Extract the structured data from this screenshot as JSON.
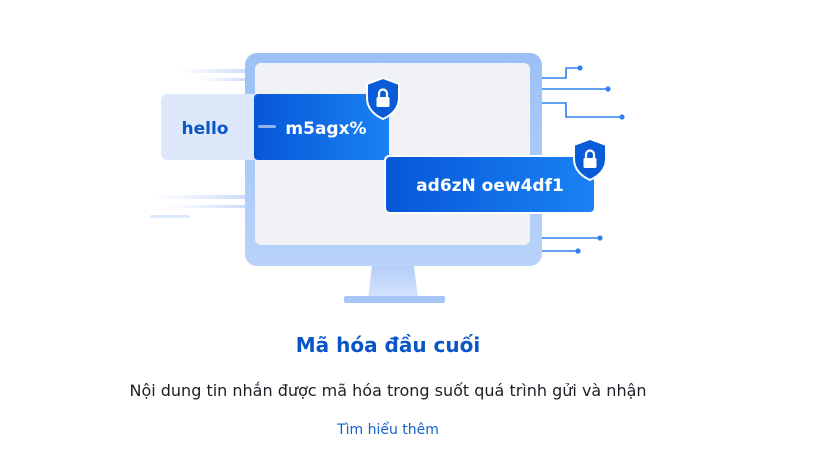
{
  "illustration": {
    "plain_message": "hello",
    "encrypted_message_1": "m5agx%",
    "encrypted_message_2": "ad6zN oew4df1",
    "icons": [
      "monitor-icon",
      "shield-lock-icon",
      "shield-lock-icon",
      "circuit-lines-icon"
    ],
    "colors": {
      "accent_blue": "#0a62e0",
      "light_blue": "#dce8fb",
      "monitor_frame": "#a9c7f7",
      "screen": "#f0f2f6"
    }
  },
  "feature": {
    "title": "Mã hóa đầu cuối",
    "description": "Nội dung tin nhắn được mã hóa trong suốt quá trình gửi và nhận",
    "learn_more_label": "Tìm hiểu thêm"
  }
}
